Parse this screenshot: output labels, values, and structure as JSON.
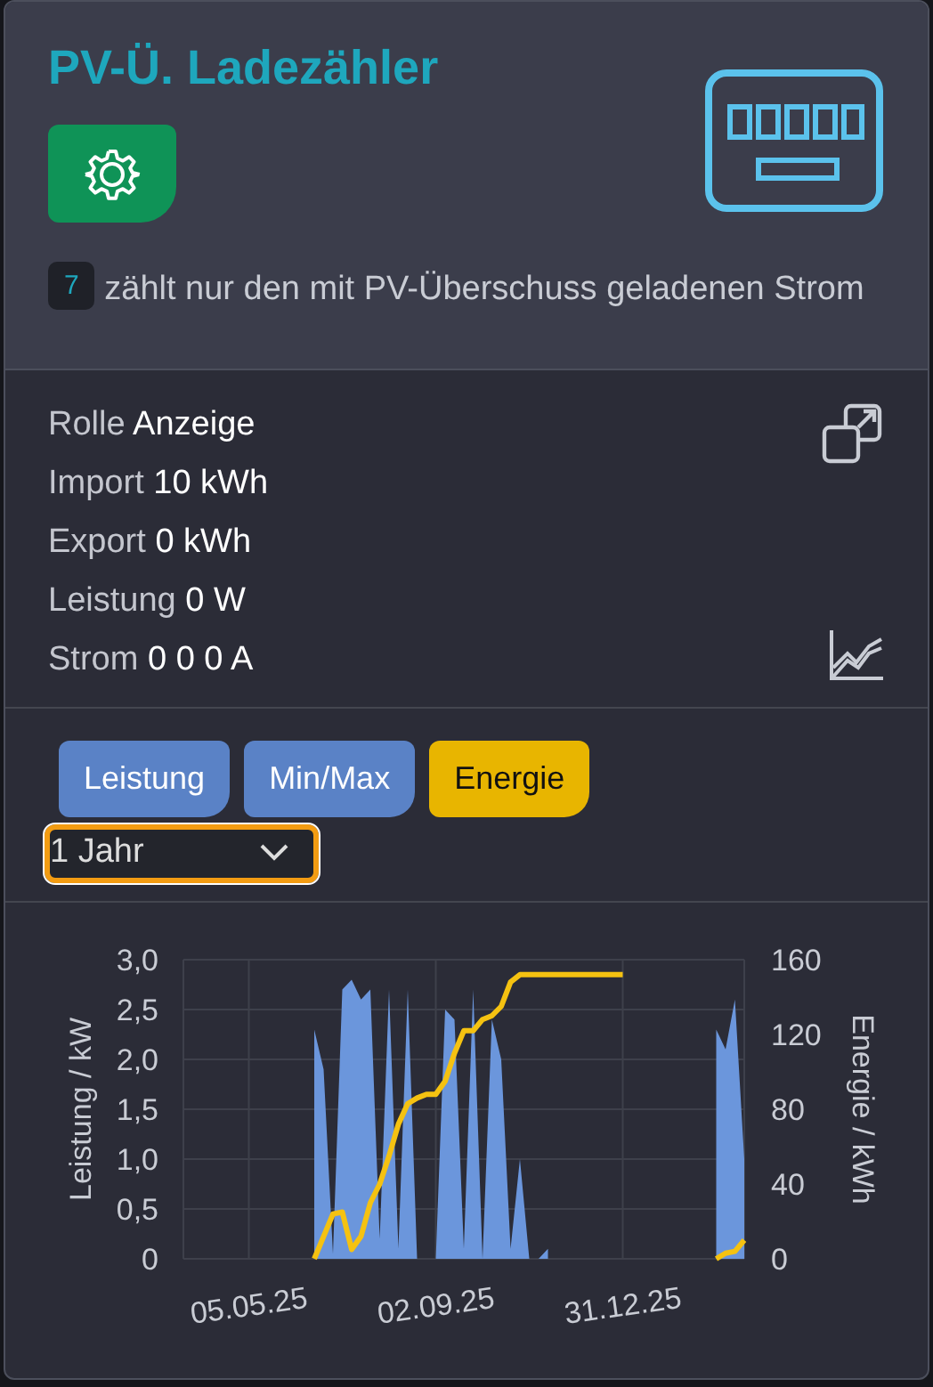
{
  "header": {
    "title": "PV-Ü. Ladezähler",
    "badge": "7",
    "description": "zählt nur den mit PV-Überschuss geladenen Strom"
  },
  "readings": [
    {
      "label": "Rolle",
      "value": "Anzeige"
    },
    {
      "label": "Import",
      "value": "10 kWh"
    },
    {
      "label": "Export",
      "value": "0 kWh"
    },
    {
      "label": "Leistung",
      "value": "0 W"
    },
    {
      "label": "Strom",
      "value": "0 0 0 A"
    }
  ],
  "chart_buttons": [
    {
      "label": "Leistung",
      "selected": false
    },
    {
      "label": "Min/Max",
      "selected": false
    },
    {
      "label": "Energie",
      "selected": true
    }
  ],
  "range_select": {
    "value": "1 Jahr"
  },
  "chart": {
    "chart_data": {
      "type": "area",
      "ylabel": "Leistung / kW",
      "y2label": "Energie / kWh",
      "categories": [
        null,
        null,
        null,
        null,
        null,
        null,
        null,
        "05.05.25",
        null,
        null,
        null,
        null,
        null,
        null,
        null,
        null,
        null,
        null,
        null,
        null,
        null,
        null,
        null,
        null,
        null,
        null,
        null,
        "02.09.25",
        null,
        null,
        null,
        null,
        null,
        null,
        null,
        null,
        null,
        null,
        null,
        null,
        null,
        null,
        null,
        null,
        null,
        null,
        null,
        "31.12.25",
        null,
        null,
        null,
        null,
        null,
        null,
        null,
        null,
        null,
        null,
        null,
        null,
        null
      ],
      "grid": true,
      "ylim": [
        0,
        3
      ],
      "yticks": [
        {
          "value": 0,
          "label": "0"
        },
        {
          "value": 0.5,
          "label": "0,5"
        },
        {
          "value": 1,
          "label": "1,0"
        },
        {
          "value": 1.5,
          "label": "1,5"
        },
        {
          "value": 2,
          "label": "2,0"
        },
        {
          "value": 2.5,
          "label": "2,5"
        },
        {
          "value": 3,
          "label": "3,0"
        }
      ],
      "y2lim": [
        0,
        160
      ],
      "y2ticks": [
        0,
        40,
        80,
        120,
        160
      ],
      "series": [
        {
          "color": "#6b96dc",
          "values": [
            null,
            null,
            null,
            null,
            null,
            null,
            null,
            null,
            null,
            null,
            null,
            null,
            null,
            null,
            2.3,
            1.9,
            0.05,
            2.7,
            2.8,
            2.6,
            2.7,
            0.2,
            2.7,
            0.1,
            2.7,
            0,
            0,
            0,
            2.5,
            2.4,
            0.1,
            2.7,
            0,
            2.4,
            2.0,
            0.1,
            1.0,
            0,
            0,
            0.1,
            null,
            null,
            null,
            null,
            null,
            null,
            null,
            null,
            null,
            null,
            null,
            null,
            null,
            null,
            null,
            null,
            null,
            2.3,
            2.1,
            2.6,
            1.0
          ]
        },
        {
          "color": "#f5c211",
          "axis": "y2",
          "type": "line",
          "values": [
            null,
            null,
            null,
            null,
            null,
            null,
            null,
            null,
            null,
            null,
            null,
            null,
            null,
            null,
            0,
            12,
            24,
            25,
            5,
            12,
            30,
            40,
            55,
            72,
            83,
            86,
            88,
            88,
            95,
            110,
            122,
            122,
            128,
            130,
            135,
            148,
            152,
            152,
            152,
            152,
            152,
            152,
            152,
            152,
            152,
            152,
            152,
            152,
            null,
            null,
            null,
            null,
            null,
            null,
            null,
            null,
            null,
            0,
            3,
            4,
            10
          ]
        }
      ]
    }
  }
}
